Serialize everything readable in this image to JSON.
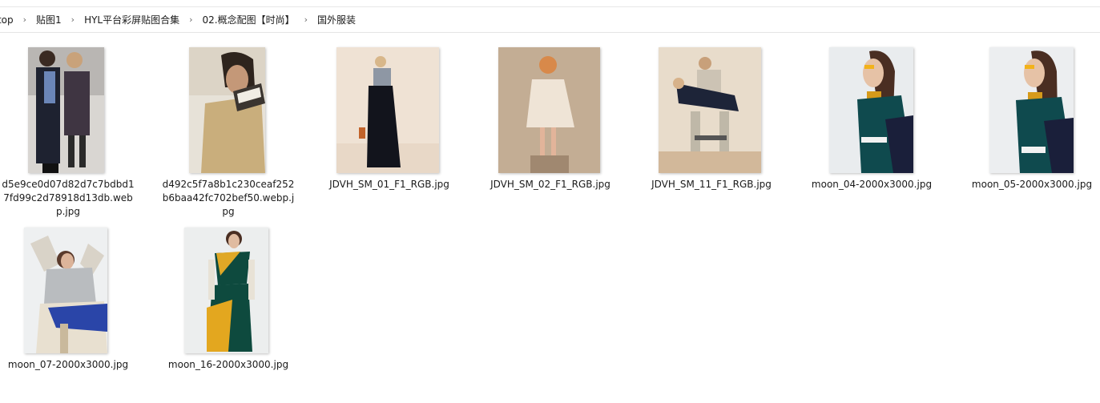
{
  "breadcrumb": [
    "ktop",
    "贴图1",
    "HYL平台彩屏贴图合集",
    "02.概念配图【时尚】",
    "国外服装"
  ],
  "files": [
    {
      "name": "d5e9ce0d07d82d7c7bdbd17fd99c2d78918d13db.webp.jpg",
      "thumb": "couple-fashion-photo"
    },
    {
      "name": "d492c5f7a8b1c230ceaf252b6baa42fc702bef50.webp.jpg",
      "thumb": "trench-coat-photo"
    },
    {
      "name": "JDVH_SM_01_F1_RGB.jpg",
      "thumb": "woman-black-skirt-photo"
    },
    {
      "name": "JDVH_SM_02_F1_RGB.jpg",
      "thumb": "child-on-pedestal-photo"
    },
    {
      "name": "JDVH_SM_11_F1_RGB.jpg",
      "thumb": "man-carrying-woman-photo"
    },
    {
      "name": "moon_04-2000x3000.jpg",
      "thumb": "teal-sweater-profile-photo"
    },
    {
      "name": "moon_05-2000x3000.jpg",
      "thumb": "teal-sweater-profile-photo-2"
    },
    {
      "name": "moon_07-2000x3000.jpg",
      "thumb": "grey-knit-blue-skirt-photo"
    },
    {
      "name": "moon_16-2000x3000.jpg",
      "thumb": "green-yellow-dress-photo"
    }
  ]
}
